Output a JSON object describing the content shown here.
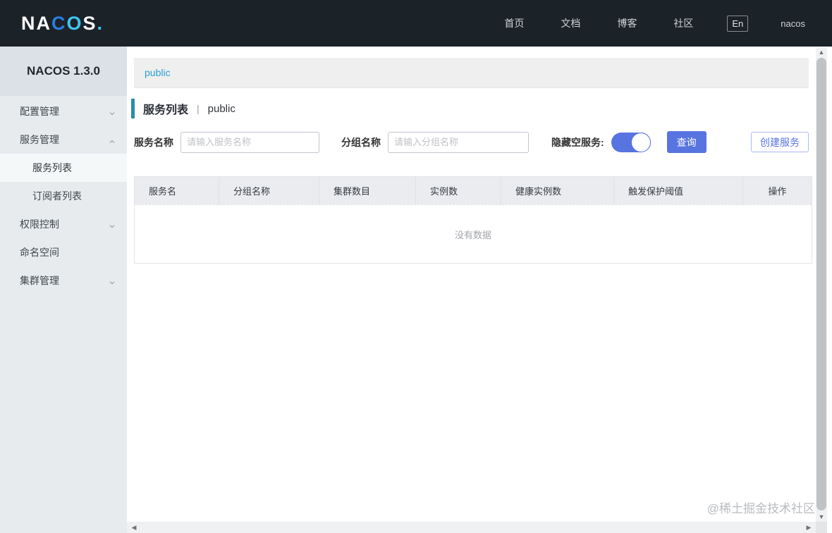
{
  "topbar": {
    "logo_parts": {
      "na": "NA",
      "c": "C",
      "o": "O",
      "s": "S",
      "dot": "."
    },
    "nav": [
      "首页",
      "文档",
      "博客",
      "社区"
    ],
    "lang": "En",
    "user": "nacos"
  },
  "sidebar": {
    "version": "NACOS 1.3.0",
    "items": [
      {
        "label": "配置管理",
        "chevron": "down"
      },
      {
        "label": "服务管理",
        "chevron": "up"
      },
      {
        "label": "服务列表",
        "sub": true,
        "active": true
      },
      {
        "label": "订阅者列表",
        "sub": true
      },
      {
        "label": "权限控制",
        "chevron": "down"
      },
      {
        "label": "命名空间"
      },
      {
        "label": "集群管理",
        "chevron": "down"
      }
    ]
  },
  "main": {
    "namespace": "public",
    "page_title": "服务列表",
    "title_separator": "|",
    "title_namespace": "public",
    "filters": {
      "service_name_label": "服务名称",
      "service_name_placeholder": "请输入服务名称",
      "service_name_value": "",
      "group_name_label": "分组名称",
      "group_name_placeholder": "请输入分组名称",
      "group_name_value": "",
      "hide_empty_label": "隐藏空服务:",
      "hide_empty_on": true,
      "search_button": "查询",
      "create_button": "创建服务"
    },
    "table": {
      "columns": [
        "服务名",
        "分组名称",
        "集群数目",
        "实例数",
        "健康实例数",
        "触发保护阈值",
        "操作"
      ],
      "empty_text": "没有数据",
      "rows": []
    },
    "watermark": "@稀土掘金技术社区"
  },
  "colors": {
    "primary_blue": "#5874e0",
    "namespace_link": "#29a0d6",
    "title_accent": "#2a8ca8",
    "topbar_bg": "#1b2228",
    "sidebar_bg": "#e7ebee",
    "table_header_bg": "#ebecf0"
  }
}
